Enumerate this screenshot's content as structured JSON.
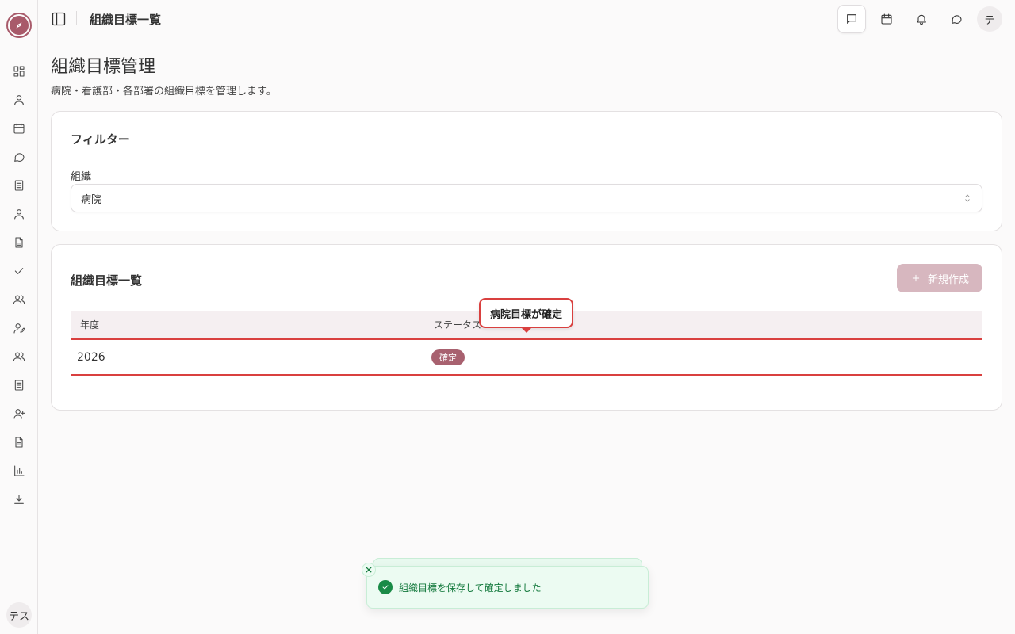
{
  "app": {
    "header_title": "組織目標一覧",
    "user_initial_header": "テ",
    "user_initial_sidebar": "テス"
  },
  "sidebar": {
    "items": [
      {
        "icon": "dashboard-icon"
      },
      {
        "icon": "user-icon"
      },
      {
        "icon": "calendar-icon"
      },
      {
        "icon": "chat-icon"
      },
      {
        "icon": "list-doc-icon"
      },
      {
        "icon": "person-icon"
      },
      {
        "icon": "document-icon"
      },
      {
        "icon": "check-icon"
      },
      {
        "icon": "users-icon"
      },
      {
        "icon": "user-edit-icon"
      },
      {
        "icon": "group-icon"
      },
      {
        "icon": "notes-icon"
      },
      {
        "icon": "user-plus-icon"
      },
      {
        "icon": "file-text-icon"
      },
      {
        "icon": "bar-chart-icon"
      },
      {
        "icon": "download-icon"
      }
    ]
  },
  "header_icons": [
    "message-square-icon",
    "calendar-icon",
    "bell-icon",
    "chat-bubble-icon"
  ],
  "main": {
    "title": "組織目標管理",
    "description": "病院・看護部・各部署の組織目標を管理します。"
  },
  "filter": {
    "title": "フィルター",
    "org_label": "組織",
    "org_value": "病院"
  },
  "list": {
    "title": "組織目標一覧",
    "new_button_label": "新規作成",
    "columns": [
      "年度",
      "ステータス"
    ],
    "rows": [
      {
        "year": "2026",
        "status": "確定"
      }
    ]
  },
  "callout": {
    "text": "病院目標が確定"
  },
  "toast": {
    "message": "組織目標を保存して確定しました"
  },
  "colors": {
    "accent": "#a85a6a",
    "highlight": "#d9403f",
    "success": "#1a8b47",
    "button_disabled": "#d7b7bf"
  }
}
